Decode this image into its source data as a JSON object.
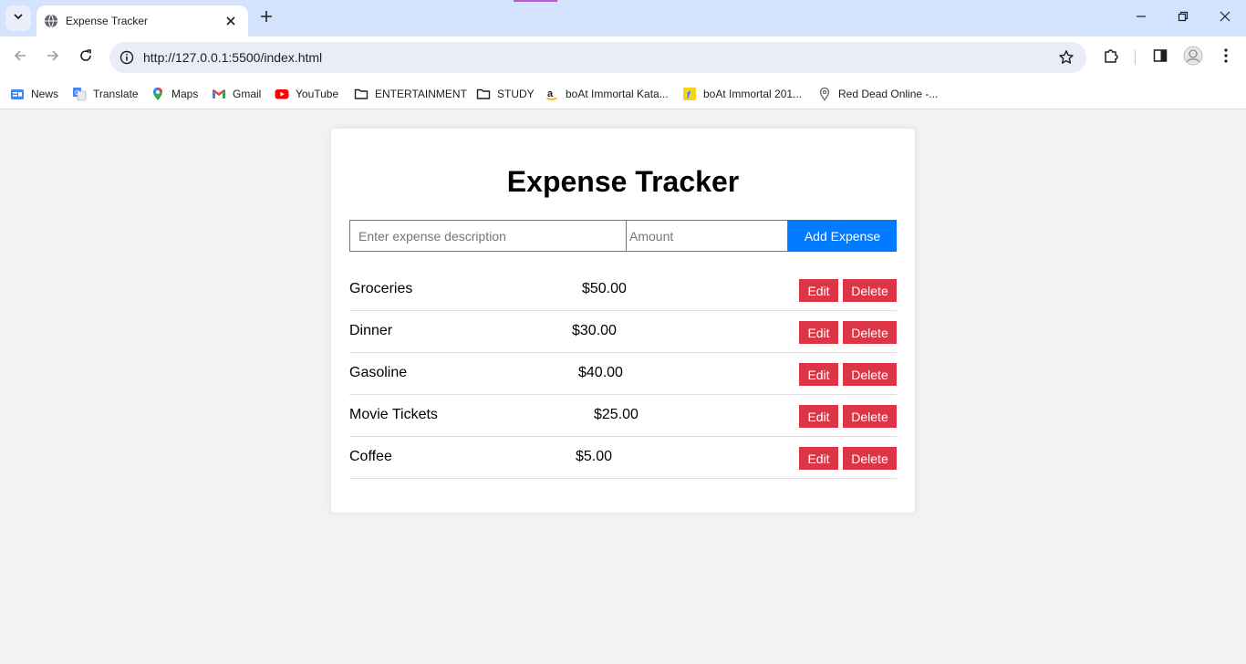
{
  "browser": {
    "tab_title": "Expense Tracker",
    "url": "http://127.0.0.1:5500/index.html",
    "bookmarks": [
      {
        "label": "News",
        "icon": "google-news-icon"
      },
      {
        "label": "Translate",
        "icon": "google-translate-icon"
      },
      {
        "label": "Maps",
        "icon": "google-maps-icon"
      },
      {
        "label": "Gmail",
        "icon": "gmail-icon"
      },
      {
        "label": "YouTube",
        "icon": "youtube-icon"
      },
      {
        "label": "ENTERTAINMENT",
        "icon": "folder-icon"
      },
      {
        "label": "STUDY",
        "icon": "folder-icon"
      },
      {
        "label": "boAt Immortal Kata...",
        "icon": "amazon-icon"
      },
      {
        "label": "boAt Immortal 201...",
        "icon": "flipkart-icon"
      },
      {
        "label": "Red Dead Online -...",
        "icon": "map-pin-icon"
      }
    ]
  },
  "app": {
    "title": "Expense Tracker",
    "description_placeholder": "Enter expense description",
    "amount_placeholder": "Amount",
    "add_button_label": "Add Expense",
    "edit_label": "Edit",
    "delete_label": "Delete",
    "expenses": [
      {
        "description": "Groceries",
        "amount": "$50.00"
      },
      {
        "description": "Dinner",
        "amount": "$30.00"
      },
      {
        "description": "Gasoline",
        "amount": "$40.00"
      },
      {
        "description": "Movie Tickets",
        "amount": "$25.00"
      },
      {
        "description": "Coffee",
        "amount": "$5.00"
      }
    ]
  },
  "colors": {
    "primary_button": "#007bff",
    "danger_button": "#dc3545",
    "page_background": "#f2f2f2"
  }
}
